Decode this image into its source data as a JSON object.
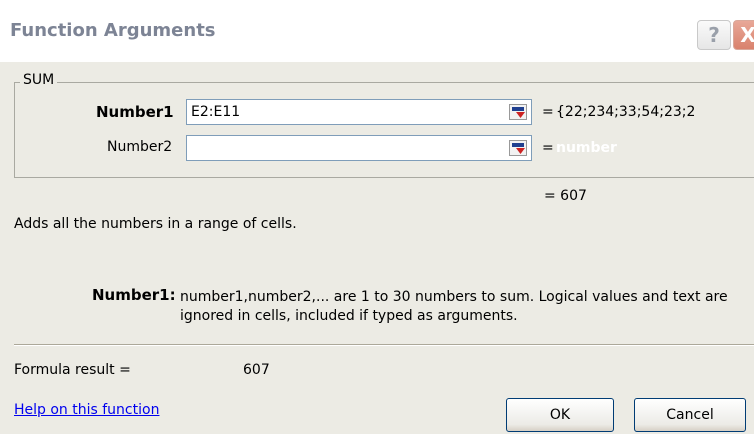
{
  "window": {
    "title": "Function Arguments",
    "help_label": "?",
    "close_label": "X"
  },
  "function_group": {
    "name": "SUM",
    "args": [
      {
        "label": "Number1",
        "value": "E2:E11",
        "equals": "=",
        "preview": "{22;234;33;54;23;2"
      },
      {
        "label": "Number2",
        "value": "",
        "equals": "=",
        "preview": "number"
      }
    ]
  },
  "result_preview": "= 607",
  "description": "Adds all the numbers in a range of cells.",
  "arg_help": {
    "label": "Number1:",
    "text": "number1,number2,... are 1 to 30 numbers to sum. Logical values and text are ignored in cells, included if typed as arguments."
  },
  "formula_result": {
    "label": "Formula result =",
    "value": "607"
  },
  "help_link": "Help on this function",
  "buttons": {
    "ok": "OK",
    "cancel": "Cancel"
  },
  "icons": {
    "collapse": "collapse-dialog-icon",
    "help": "help-icon",
    "close": "close-icon"
  },
  "colors": {
    "dialog_bg": "#ecebe4",
    "title_text": "#7d8495",
    "link": "#0000ee",
    "close_button": "#d9826d"
  }
}
